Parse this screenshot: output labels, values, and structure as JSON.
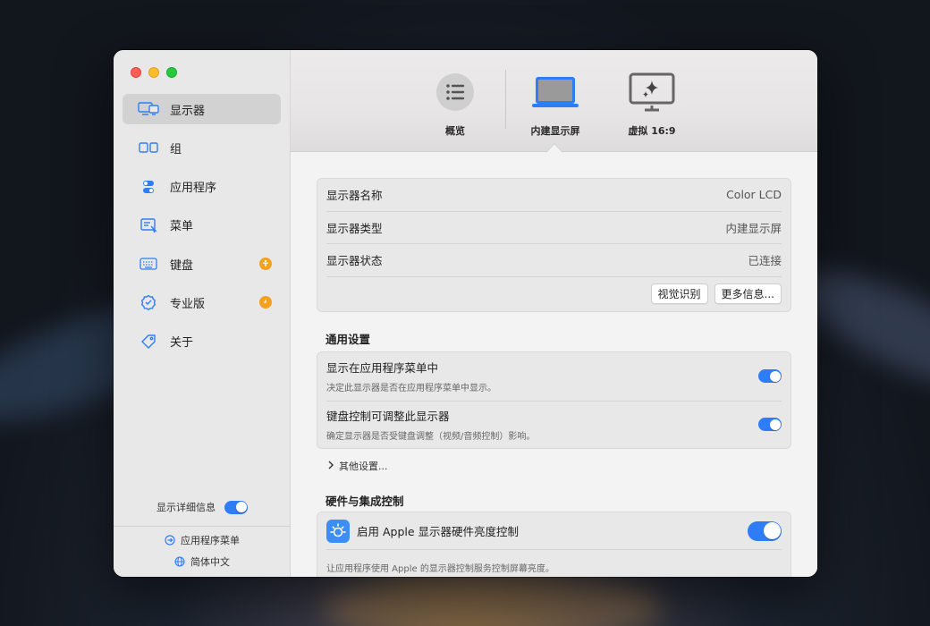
{
  "sidebar": {
    "items": [
      {
        "label": "显示器",
        "icon": "displays-icon",
        "active": true
      },
      {
        "label": "组",
        "icon": "groups-icon"
      },
      {
        "label": "应用程序",
        "icon": "apps-icon"
      },
      {
        "label": "菜单",
        "icon": "menu-icon"
      },
      {
        "label": "键盘",
        "icon": "keyboard-icon",
        "badge": "accessibility-badge-icon"
      },
      {
        "label": "专业版",
        "icon": "pro-badge-icon",
        "badge": "clock-badge-icon"
      },
      {
        "label": "关于",
        "icon": "tag-icon"
      }
    ],
    "show_details_label": "显示详细信息",
    "app_menu_label": "应用程序菜单",
    "language_label": "简体中文"
  },
  "tabs": [
    {
      "label": "概览",
      "icon": "list-icon"
    },
    {
      "label": "内建显示屏",
      "icon": "laptop-icon",
      "selected": true
    },
    {
      "label": "虚拟 16:9",
      "icon": "virtual-display-icon"
    }
  ],
  "info": {
    "rows": [
      {
        "key": "显示器名称",
        "value": "Color LCD"
      },
      {
        "key": "显示器类型",
        "value": "内建显示屏"
      },
      {
        "key": "显示器状态",
        "value": "已连接"
      }
    ],
    "identify_button": "视觉识别",
    "more_info_button": "更多信息..."
  },
  "general": {
    "title": "通用设置",
    "settings": [
      {
        "title": "显示在应用程序菜单中",
        "desc": "决定此显示器是否在应用程序菜单中显示。",
        "on": true
      },
      {
        "title": "键盘控制可调整此显示器",
        "desc": "确定显示器是否受键盘调整（视频/音频控制）影响。",
        "on": true
      }
    ],
    "other_settings": "其他设置..."
  },
  "hardware": {
    "title": "硬件与集成控制",
    "setting_title": "启用 Apple 显示器硬件亮度控制",
    "setting_desc": "让应用程序使用 Apple 的显示器控制服务控制屏幕亮度。",
    "on": true
  },
  "colors": {
    "accent": "#2f7df6",
    "badge": "#f5a01f"
  }
}
